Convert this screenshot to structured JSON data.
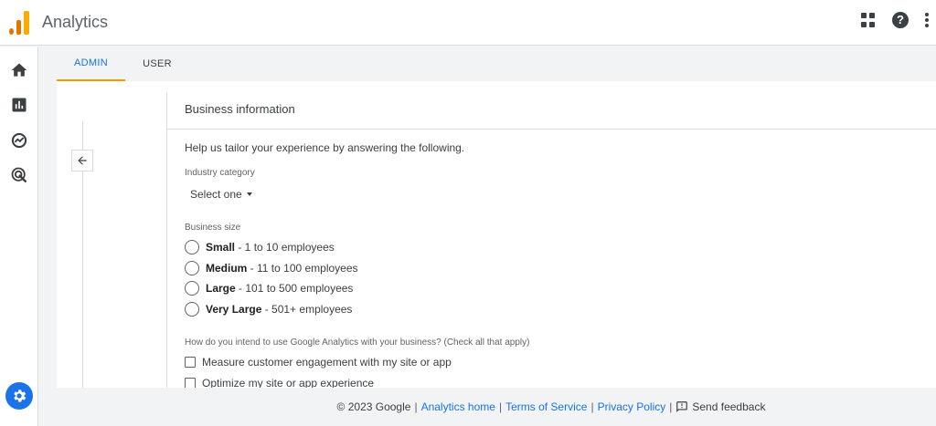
{
  "header": {
    "app_title": "Analytics",
    "logo_colors": [
      "#f9ab00",
      "#e37400"
    ],
    "icons": [
      "apps-icon",
      "help-icon",
      "more-vert-icon"
    ]
  },
  "rail": {
    "items": [
      "home-icon",
      "reports-icon",
      "explore-icon",
      "advertising-icon"
    ],
    "settings_icon": "settings-icon",
    "accent": "#1a73e8"
  },
  "tabs": [
    {
      "label": "ADMIN",
      "active": true
    },
    {
      "label": "USER",
      "active": false
    }
  ],
  "form": {
    "title": "Business information",
    "intro": "Help us tailor your experience by answering the following.",
    "industry": {
      "label": "Industry category",
      "value": "Select one"
    },
    "size": {
      "label": "Business size",
      "options": [
        {
          "bold": "Small",
          "rest": " - 1 to 10 employees"
        },
        {
          "bold": "Medium",
          "rest": " - 11 to 100 employees"
        },
        {
          "bold": "Large",
          "rest": " - 101 to 500 employees"
        },
        {
          "bold": "Very Large",
          "rest": " - 501+ employees"
        }
      ]
    },
    "usage": {
      "label": "How do you intend to use Google Analytics with your business? (Check all that apply)",
      "options": [
        "Measure customer engagement with my site or app",
        "Optimize my site or app experience"
      ]
    }
  },
  "footer": {
    "copyright": "© 2023 Google",
    "sep": "|",
    "links": [
      "Analytics home",
      "Terms of Service",
      "Privacy Policy"
    ],
    "feedback": "Send feedback"
  }
}
